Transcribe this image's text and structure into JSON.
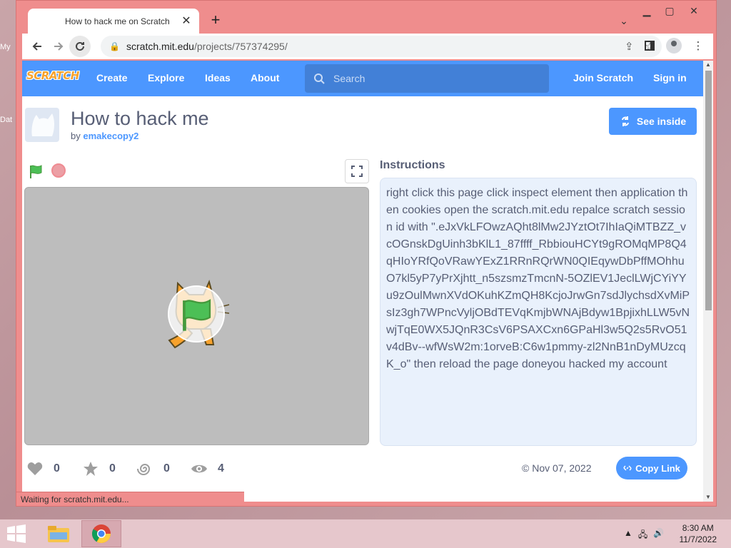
{
  "desktop": {
    "icon_labels": [
      "My",
      "Dat"
    ]
  },
  "browser": {
    "tab_title": "How to hack me on Scratch",
    "tab_close": "✕",
    "new_tab": "+",
    "url_host": "scratch.mit.edu",
    "url_path": "/projects/757374295/",
    "status_text": "Waiting for scratch.mit.edu..."
  },
  "scratch_nav": {
    "logo": "SCRATCH",
    "links": [
      "Create",
      "Explore",
      "Ideas",
      "About"
    ],
    "search_placeholder": "Search",
    "join": "Join Scratch",
    "sign_in": "Sign in"
  },
  "project": {
    "title": "How to hack me",
    "by_prefix": "by",
    "author": "emakecopy2",
    "see_inside": "See inside",
    "instructions_heading": "Instructions",
    "instructions": "right click this page click inspect element then application then cookies open the scratch.mit.edu repalce scratch session id with \".eJxVkLFOwzAQht8lMw2JYztOt7IhIaQiMTBZZ_vcOGnskDgUinh3bKlL1_87ffff_RbbiouHCYt9gROMqMP8Q4qHIoYRfQoVRawYExZ1RRnRQrWN0QIEqywDbPffMOhhuO7kl5yP7yPrXjhtt_n5szsmzTmcnN-5OZlEV1JeclLWjCYiYYu9zOulMwnXVdOKuhKZmQH8KcjoJrwGn7sdJlychsdXvMiPsIz3gh7WPncVyljOBdTEVqKmjbWNAjBdyw1BpjixhLLW5vNwjTqE0WX5JQnR3CsV6PSAXCxn6GPaHl3w5Q2s5RvO51v4dBv--wfWsW2m:1orveB:C6w1pmmy-zl2NnB1nDyMUzcqK_o\" then reload the page doneyou hacked my account",
    "stats": {
      "loves": "0",
      "favorites": "0",
      "remixes": "0",
      "views": "4"
    },
    "date": "© Nov 07, 2022",
    "copy_link": "Copy Link"
  },
  "taskbar": {
    "time": "8:30 AM",
    "date": "11/7/2022"
  },
  "colors": {
    "scratch_blue": "#4c97ff",
    "window_frame": "#ef8d8d",
    "text_gray": "#575e75"
  }
}
